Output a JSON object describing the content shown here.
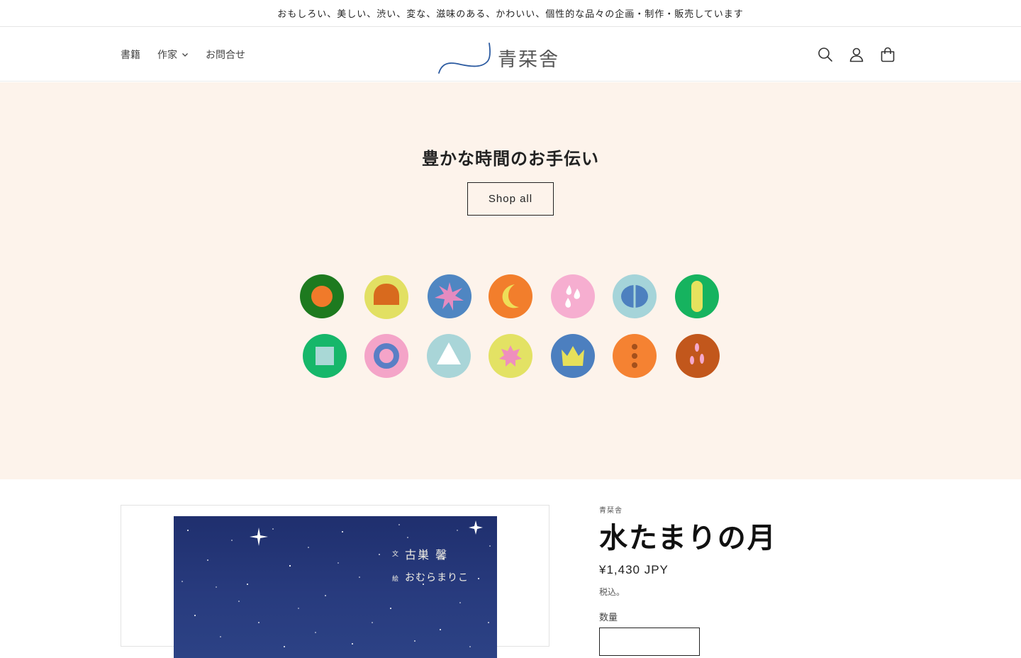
{
  "announcement": "おもしろい、美しい、渋い、変な、滋味のある、かわいい、個性的な品々の企画・制作・販売しています",
  "nav": {
    "books": "書籍",
    "authors": "作家",
    "contact": "お問合せ"
  },
  "logo": {
    "text": "青栞舎"
  },
  "header_icons": [
    "search-icon",
    "account-icon",
    "cart-icon"
  ],
  "hero": {
    "title": "豊かな時間のお手伝い",
    "button": "Shop all",
    "background": "#fdf3eb"
  },
  "product": {
    "vendor": "青栞舎",
    "title": "水たまりの月",
    "price": "¥1,430 JPY",
    "tax_note": "税込。",
    "quantity_label": "数量",
    "cover": {
      "text_label": "文",
      "author": "古巣 馨",
      "illustration_label": "絵",
      "illustrator": "おむらまりこ"
    }
  }
}
